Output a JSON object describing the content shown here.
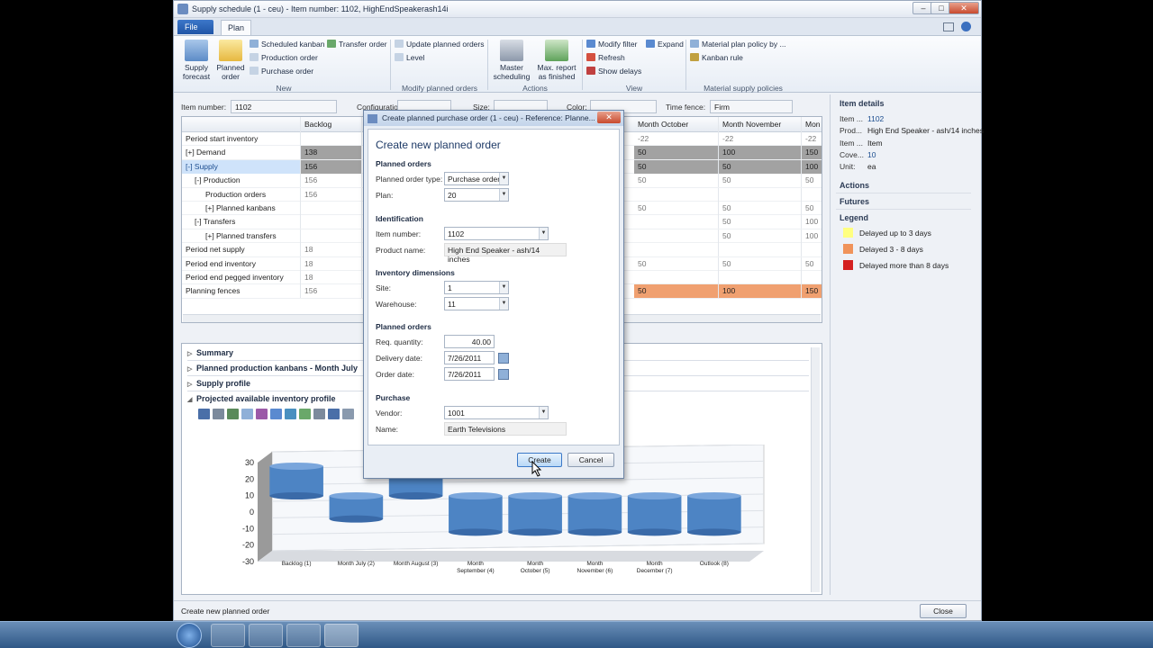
{
  "window": {
    "title": "Supply schedule (1 - ceu) - Item number: 1102, HighEndSpeakerash14i",
    "controls": [
      "–",
      "□",
      "✕"
    ]
  },
  "ribbon": {
    "file_tab": "File",
    "plan_tab": "Plan",
    "supply_forecast": "Supply forecast",
    "planned_order": "Planned order",
    "scheduled_kanban": "Scheduled kanban",
    "production_order": "Production order",
    "purchase_order": "Purchase order",
    "transfer_order": "Transfer order",
    "group_new": "New",
    "update_planned_orders": "Update planned orders",
    "level": "Level",
    "group_modify": "Modify planned orders",
    "master_scheduling": "Master scheduling",
    "max_report": "Max. report as finished",
    "group_actions": "Actions",
    "modify_filter": "Modify filter",
    "expand": "Expand",
    "refresh": "Refresh",
    "show_delays": "Show delays",
    "group_view": "View",
    "material_plan_policy": "Material plan policy by ...",
    "kanban_rule": "Kanban rule",
    "group_material": "Material supply policies"
  },
  "fields": {
    "item_number_label": "Item number:",
    "item_number": "1102",
    "configuration_label": "Configuration:",
    "size_label": "Size:",
    "color_label": "Color:",
    "time_fence_label": "Time fence:",
    "time_fence": "Firm"
  },
  "grid": {
    "columns": [
      "Backlog",
      "Month October",
      "Month November",
      "Mon"
    ],
    "rows": [
      {
        "label": "Period start inventory",
        "backlog": "",
        "oct": "-22",
        "nov": "-22",
        "mon": "-22"
      },
      {
        "label": "[+] Demand",
        "backlog": "138",
        "oct": "50",
        "nov": "100",
        "mon": "150"
      },
      {
        "label": "[-] Supply",
        "backlog": "156",
        "oct": "50",
        "nov": "50",
        "mon": "100"
      },
      {
        "label": "[-] Production",
        "backlog": "156",
        "oct": "50",
        "nov": "50",
        "mon": "50"
      },
      {
        "label": "Production orders",
        "backlog": "156",
        "oct": "",
        "nov": "",
        "mon": ""
      },
      {
        "label": "[+] Planned kanbans",
        "backlog": "",
        "oct": "50",
        "nov": "50",
        "mon": "50"
      },
      {
        "label": "[-] Transfers",
        "backlog": "",
        "oct": "",
        "nov": "50",
        "mon": "100"
      },
      {
        "label": "[+] Planned transfers",
        "backlog": "",
        "oct": "",
        "nov": "50",
        "mon": "100"
      },
      {
        "label": "Period net supply",
        "backlog": "18",
        "oct": "",
        "nov": "",
        "mon": ""
      },
      {
        "label": "Period end inventory",
        "backlog": "18",
        "oct": "50",
        "nov": "50",
        "mon": "50"
      },
      {
        "label": "Period end pegged inventory",
        "backlog": "18",
        "oct": "",
        "nov": "",
        "mon": ""
      },
      {
        "label": "Planning fences",
        "backlog": "156",
        "oct": "50",
        "nov": "100",
        "mon": "150"
      }
    ]
  },
  "sections": {
    "summary": "Summary",
    "kanbans": "Planned production kanbans - Month July",
    "supply_profile": "Supply profile",
    "projected": "Projected available inventory profile"
  },
  "chart_data": {
    "type": "bar",
    "categories": [
      "Backlog (1)",
      "Month July (2)",
      "Month August (3)",
      "Month September (4)",
      "Month October (5)",
      "Month November (6)",
      "Month December (7)",
      "Outlook (8)"
    ],
    "values": [
      18,
      -14,
      20,
      -22,
      -22,
      -22,
      -22,
      -22
    ],
    "ylim": [
      -30,
      30
    ],
    "yticks": [
      "30",
      "20",
      "10",
      "0",
      "-10",
      "-20",
      "-30"
    ],
    "bar_color": "#4d84c4"
  },
  "right_pane": {
    "item_details": "Item details",
    "item_label": "Item ...",
    "item_value": "1102",
    "prod_label": "Prod...",
    "prod_value": "High End Speaker - ash/14 inches",
    "item2_label": "Item ...",
    "item2_value": "Item",
    "cove_label": "Cove...",
    "cove_value": "10",
    "unit_label": "Unit:",
    "unit_value": "ea",
    "actions": "Actions",
    "futures": "Futures",
    "legend": "Legend",
    "legend_items": [
      {
        "label": "Delayed up to 3 days",
        "color": "#ffff80"
      },
      {
        "label": "Delayed 3 - 8 days",
        "color": "#f0935a"
      },
      {
        "label": "Delayed more than 8 days",
        "color": "#d42020"
      }
    ]
  },
  "status": {
    "text": "Create new planned order",
    "close": "Close"
  },
  "dialog": {
    "title": "Create planned purchase order (1 - ceu) - Reference: Planne...",
    "heading": "Create new planned order",
    "sec_planned_orders": "Planned orders",
    "planned_order_type_label": "Planned order type:",
    "planned_order_type": "Purchase order",
    "plan_label": "Plan:",
    "plan": "20",
    "sec_identification": "Identification",
    "item_number_label": "Item number:",
    "item_number": "1102",
    "product_name_label": "Product name:",
    "product_name": "High End Speaker - ash/14 inches",
    "sec_inventory": "Inventory dimensions",
    "site_label": "Site:",
    "site": "1",
    "warehouse_label": "Warehouse:",
    "warehouse": "11",
    "sec_planned_orders2": "Planned orders",
    "req_qty_label": "Req. quantity:",
    "req_qty": "40.00",
    "delivery_date_label": "Delivery date:",
    "delivery_date": "7/26/2011",
    "order_date_label": "Order date:",
    "order_date": "7/26/2011",
    "sec_purchase": "Purchase",
    "vendor_label": "Vendor:",
    "vendor": "1001",
    "name_label": "Name:",
    "name": "Earth Televisions",
    "create": "Create",
    "cancel": "Cancel"
  }
}
